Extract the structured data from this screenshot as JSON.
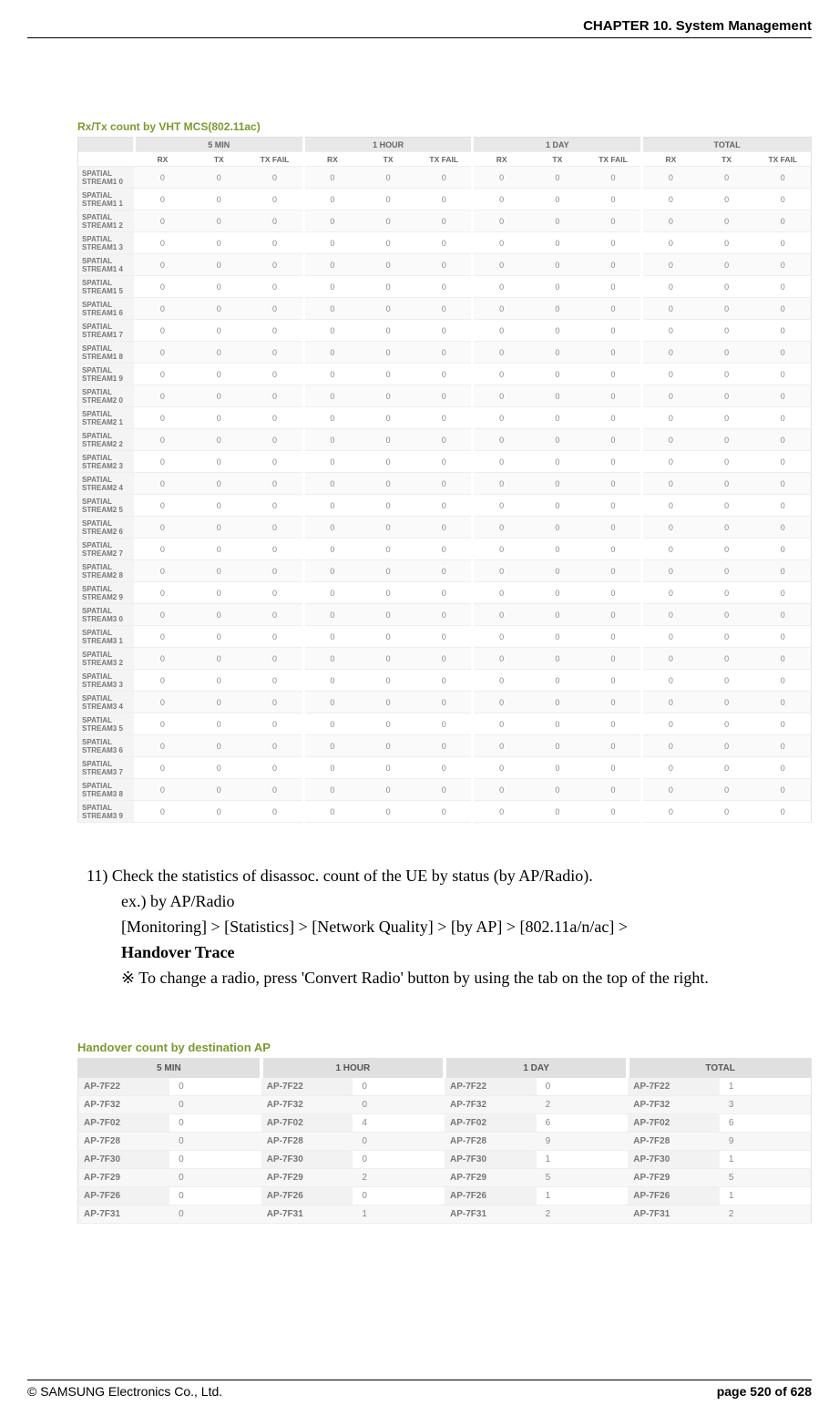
{
  "header": {
    "chapter": "CHAPTER 10. System Management"
  },
  "table1": {
    "title": "Rx/Tx count by VHT MCS(802.11ac)",
    "groups": [
      "5 MIN",
      "1 HOUR",
      "1 DAY",
      "TOTAL"
    ],
    "subcols": [
      "RX",
      "TX",
      "TX FAIL"
    ],
    "rows": [
      "SPATIAL STREAM1 0",
      "SPATIAL STREAM1 1",
      "SPATIAL STREAM1 2",
      "SPATIAL STREAM1 3",
      "SPATIAL STREAM1 4",
      "SPATIAL STREAM1 5",
      "SPATIAL STREAM1 6",
      "SPATIAL STREAM1 7",
      "SPATIAL STREAM1 8",
      "SPATIAL STREAM1 9",
      "SPATIAL STREAM2 0",
      "SPATIAL STREAM2 1",
      "SPATIAL STREAM2 2",
      "SPATIAL STREAM2 3",
      "SPATIAL STREAM2 4",
      "SPATIAL STREAM2 5",
      "SPATIAL STREAM2 6",
      "SPATIAL STREAM2 7",
      "SPATIAL STREAM2 8",
      "SPATIAL STREAM2 9",
      "SPATIAL STREAM3 0",
      "SPATIAL STREAM3 1",
      "SPATIAL STREAM3 2",
      "SPATIAL STREAM3 3",
      "SPATIAL STREAM3 4",
      "SPATIAL STREAM3 5",
      "SPATIAL STREAM3 6",
      "SPATIAL STREAM3 7",
      "SPATIAL STREAM3 8",
      "SPATIAL STREAM3 9"
    ],
    "zero": "0"
  },
  "body": {
    "line1": "11) Check the statistics of disassoc. count of the UE by status (by AP/Radio).",
    "line2": "ex.) by AP/Radio",
    "line3": "[Monitoring] > [Statistics] > [Network Quality] > [by AP] > [802.11a/n/ac] >",
    "line4": "Handover Trace",
    "line5": "※  To change a radio, press 'Convert Radio' button by using the tab on the top of the right."
  },
  "table2": {
    "title": "Handover count by destination AP",
    "groups": [
      "5 MIN",
      "1 HOUR",
      "1 DAY",
      "TOTAL"
    ],
    "aps": [
      "AP-7F22",
      "AP-7F32",
      "AP-7F02",
      "AP-7F28",
      "AP-7F30",
      "AP-7F29",
      "AP-7F26",
      "AP-7F31"
    ],
    "values": {
      "5min": [
        "0",
        "0",
        "0",
        "0",
        "0",
        "0",
        "0",
        "0"
      ],
      "1hour": [
        "0",
        "0",
        "4",
        "0",
        "0",
        "2",
        "0",
        "1"
      ],
      "1day": [
        "0",
        "2",
        "6",
        "9",
        "1",
        "5",
        "1",
        "2"
      ],
      "total": [
        "1",
        "3",
        "6",
        "9",
        "1",
        "5",
        "1",
        "2"
      ]
    }
  },
  "footer": {
    "copyright": "© SAMSUNG Electronics Co., Ltd.",
    "page_label": "page 520 of 628"
  }
}
